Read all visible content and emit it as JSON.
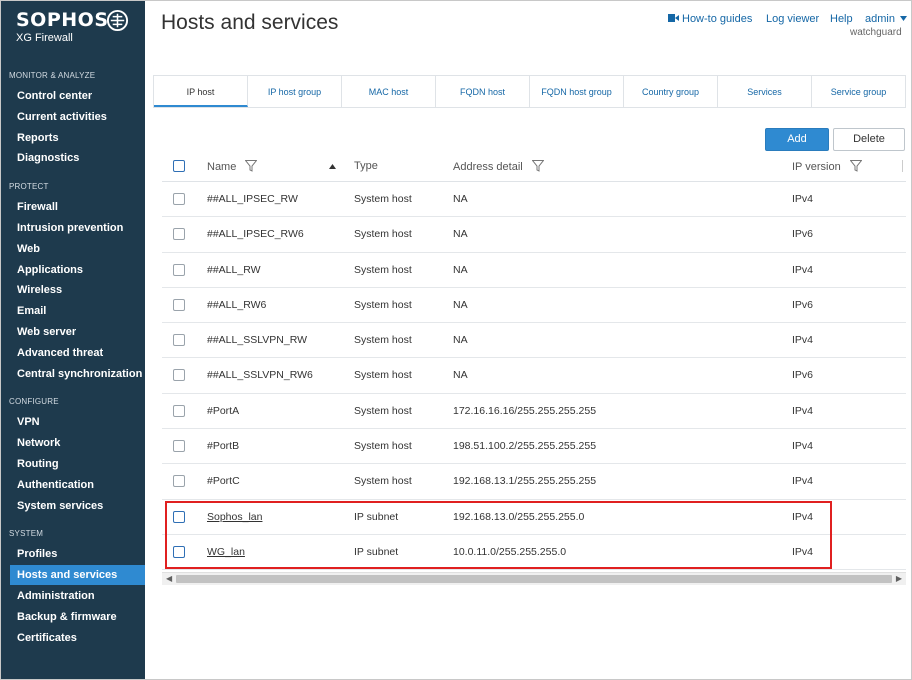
{
  "brand": {
    "name": "SOPHOS",
    "product": "XG Firewall"
  },
  "sidebar": {
    "sections": [
      {
        "title": "MONITOR & ANALYZE",
        "items": [
          "Control center",
          "Current activities",
          "Reports",
          "Diagnostics"
        ]
      },
      {
        "title": "PROTECT",
        "items": [
          "Firewall",
          "Intrusion prevention",
          "Web",
          "Applications",
          "Wireless",
          "Email",
          "Web server",
          "Advanced threat",
          "Central synchronization"
        ]
      },
      {
        "title": "CONFIGURE",
        "items": [
          "VPN",
          "Network",
          "Routing",
          "Authentication",
          "System services"
        ]
      },
      {
        "title": "SYSTEM",
        "items": [
          "Profiles",
          "Hosts and services",
          "Administration",
          "Backup & firmware",
          "Certificates"
        ]
      }
    ],
    "active_item": "Hosts and services"
  },
  "header": {
    "title": "Hosts and services",
    "links": {
      "guides": "How-to guides",
      "log_viewer": "Log viewer",
      "help": "Help",
      "user": "admin"
    },
    "user_sub": "watchguard"
  },
  "tabs": [
    "IP host",
    "IP host group",
    "MAC host",
    "FQDN host",
    "FQDN host group",
    "Country group",
    "Services",
    "Service group"
  ],
  "active_tab": "IP host",
  "toolbar": {
    "add": "Add",
    "delete": "Delete"
  },
  "table": {
    "columns": {
      "name": "Name",
      "type": "Type",
      "address": "Address detail",
      "ipversion": "IP version"
    },
    "rows": [
      {
        "name": "##ALL_IPSEC_RW",
        "type": "System host",
        "address": "NA",
        "ipversion": "IPv4"
      },
      {
        "name": "##ALL_IPSEC_RW6",
        "type": "System host",
        "address": "NA",
        "ipversion": "IPv6"
      },
      {
        "name": "##ALL_RW",
        "type": "System host",
        "address": "NA",
        "ipversion": "IPv4"
      },
      {
        "name": "##ALL_RW6",
        "type": "System host",
        "address": "NA",
        "ipversion": "IPv6"
      },
      {
        "name": "##ALL_SSLVPN_RW",
        "type": "System host",
        "address": "NA",
        "ipversion": "IPv4"
      },
      {
        "name": "##ALL_SSLVPN_RW6",
        "type": "System host",
        "address": "NA",
        "ipversion": "IPv6"
      },
      {
        "name": "#PortA",
        "type": "System host",
        "address": "172.16.16.16/255.255.255.255",
        "ipversion": "IPv4"
      },
      {
        "name": "#PortB",
        "type": "System host",
        "address": "198.51.100.2/255.255.255.255",
        "ipversion": "IPv4"
      },
      {
        "name": "#PortC",
        "type": "System host",
        "address": "192.168.13.1/255.255.255.255",
        "ipversion": "IPv4"
      },
      {
        "name": "Sophos_lan",
        "type": "IP subnet",
        "address": "192.168.13.0/255.255.255.0",
        "ipversion": "IPv4",
        "link": true
      },
      {
        "name": "WG_lan",
        "type": "IP subnet",
        "address": "10.0.11.0/255.255.255.0",
        "ipversion": "IPv4",
        "link": true
      }
    ]
  },
  "colors": {
    "sidebar_bg": "#1e3a4d",
    "accent": "#2f8ad1",
    "link": "#1567a6",
    "highlight": "#e02020"
  }
}
